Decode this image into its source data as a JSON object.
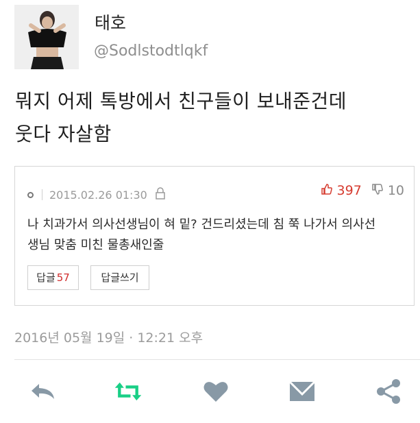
{
  "tweet": {
    "display_name": "태호",
    "handle": "@Sodlstodtlqkf",
    "text_line1": "뭐지 어제 톡방에서 친구들이 보내준건데",
    "text_line2": "웃다 자살함",
    "timestamp": "2016년 05월 19일 · 12:21 오후"
  },
  "card": {
    "datetime": "2015.02.26 01:30",
    "upvotes": "397",
    "downvotes": "10",
    "comment_line1": "나 치과가서 의사선생님이 혀 밑? 건드리셨는데 침 쭉 나가서 의사선",
    "comment_line2": "생님 맞춤 미친 물총새인줄",
    "reply_label": "답글",
    "reply_count": "57",
    "write_reply_label": "답글쓰기"
  },
  "colors": {
    "retweet_green": "#19cf86",
    "icon_gray": "#8899a6",
    "upvote_red": "#d63b2f"
  },
  "icons": {
    "reply": "reply-icon",
    "retweet": "retweet-icon",
    "like": "heart-icon",
    "message": "envelope-icon",
    "share": "share-icon",
    "thumbs_up": "thumbs-up-icon",
    "thumbs_down": "thumbs-down-icon",
    "lock": "lock-icon"
  }
}
